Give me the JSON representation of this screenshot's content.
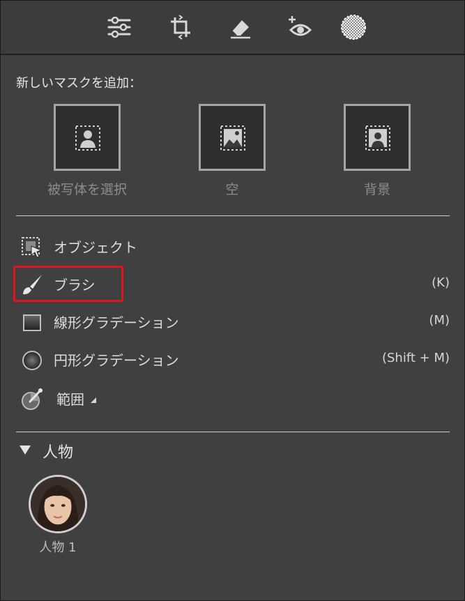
{
  "toolbar": {
    "tools": [
      {
        "icon": "sliders-icon"
      },
      {
        "icon": "crop-icon"
      },
      {
        "icon": "eraser-icon"
      },
      {
        "icon": "red-eye-icon"
      },
      {
        "icon": "masking-icon",
        "active": true
      }
    ]
  },
  "masks": {
    "add_label": "新しいマスクを追加：",
    "quick": [
      {
        "label": "被写体を選択",
        "icon": "select-subject-icon"
      },
      {
        "label": "空",
        "icon": "select-sky-icon"
      },
      {
        "label": "背景",
        "icon": "select-background-icon"
      }
    ],
    "tools": [
      {
        "label": "オブジェクト",
        "shortcut": "",
        "icon": "object-select-icon"
      },
      {
        "label": "ブラシ",
        "shortcut": "(K)",
        "icon": "brush-icon",
        "highlighted": true
      },
      {
        "label": "線形グラデーション",
        "shortcut": "(M)",
        "icon": "linear-gradient-icon"
      },
      {
        "label": "円形グラデーション",
        "shortcut": "(Shift + M)",
        "icon": "radial-gradient-icon"
      },
      {
        "label": "範囲",
        "shortcut": "",
        "icon": "range-icon"
      }
    ]
  },
  "people": {
    "section_title": "人物",
    "items": [
      {
        "label": "人物 1"
      }
    ]
  },
  "colors": {
    "highlight": "#e0141c",
    "panel": "#404040"
  }
}
